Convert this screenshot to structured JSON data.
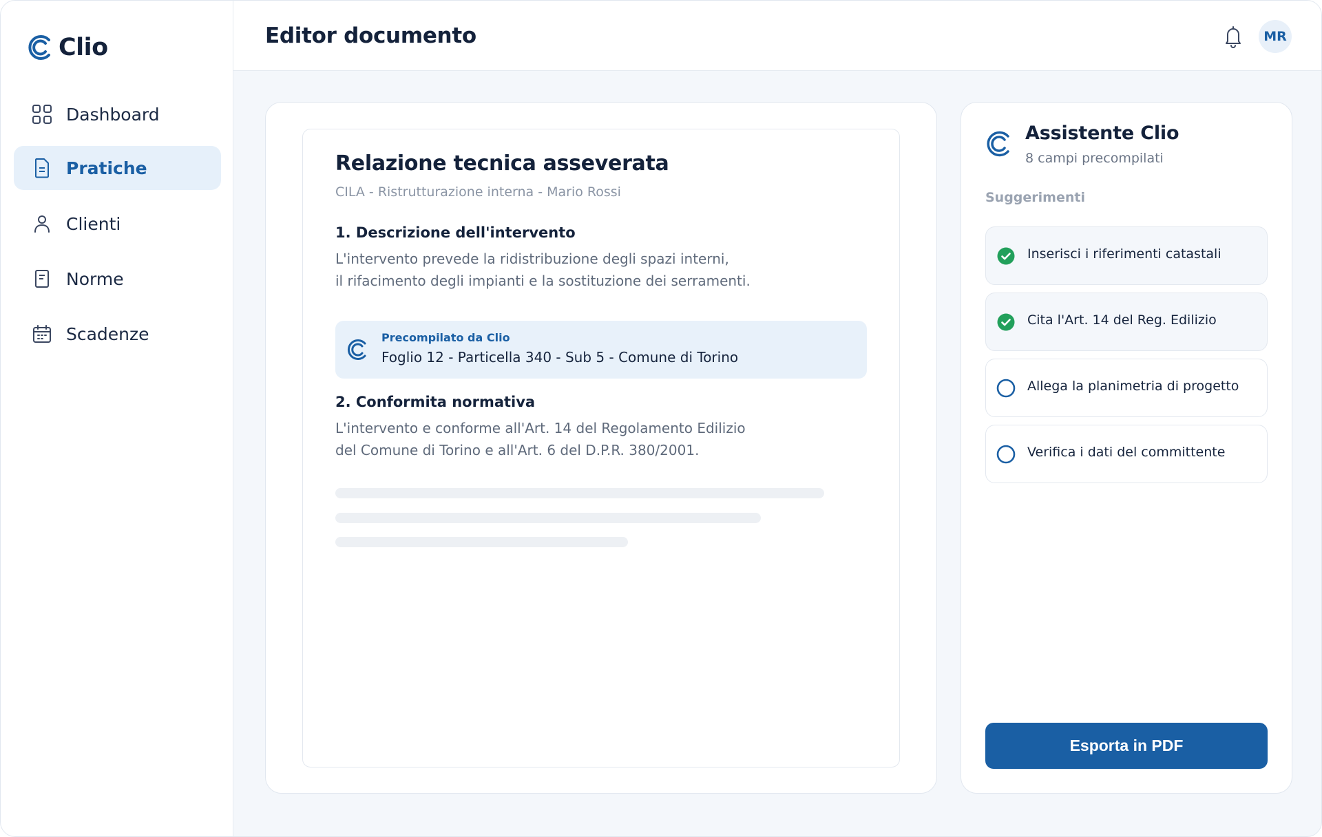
{
  "app": {
    "name": "Clio",
    "brand_color": "#1a5fa4",
    "text_color": "#14223b"
  },
  "sidebar": {
    "items": [
      {
        "label": "Dashboard",
        "icon": "grid-icon",
        "active": false
      },
      {
        "label": "Pratiche",
        "icon": "document-icon",
        "active": true
      },
      {
        "label": "Clienti",
        "icon": "user-icon",
        "active": false
      },
      {
        "label": "Norme",
        "icon": "book-icon",
        "active": false
      },
      {
        "label": "Scadenze",
        "icon": "calendar-icon",
        "active": false
      }
    ]
  },
  "header": {
    "title": "Editor documento",
    "notification_icon": "bell-icon",
    "avatar_initials": "MR"
  },
  "document": {
    "title": "Relazione tecnica asseverata",
    "subtitle": "CILA - Ristrutturazione interna - Mario Rossi",
    "sections": [
      {
        "title": "1. Descrizione dell'intervento",
        "lines": [
          "L'intervento prevede la ridistribuzione degli spazi interni,",
          "il rifacimento degli impianti e la sostituzione dei serramenti."
        ]
      },
      {
        "title": "2. Conformita normativa",
        "lines": [
          "L'intervento e conforme all'Art. 14 del Regolamento Edilizio",
          "del Comune di Torino e all'Art. 6 del D.P.R. 380/2001."
        ]
      }
    ],
    "prefill": {
      "label": "Precompilato da Clio",
      "value": "Foglio 12 - Particella 340 - Sub 5 - Comune di Torino",
      "background": "#e8f1fa"
    }
  },
  "assistant": {
    "title": "Assistente Clio",
    "subtitle": "8 campi precompilati",
    "section_label": "Suggerimenti",
    "suggestions": [
      {
        "label": "Inserisci i riferimenti catastali",
        "done": true
      },
      {
        "label": "Cita l'Art. 14 del Reg. Edilizio",
        "done": true
      },
      {
        "label": "Allega la planimetria di progetto",
        "done": false
      },
      {
        "label": "Verifica i dati del committente",
        "done": false
      }
    ],
    "check_color": "#22a05b",
    "export_label": "Esporta in PDF"
  }
}
